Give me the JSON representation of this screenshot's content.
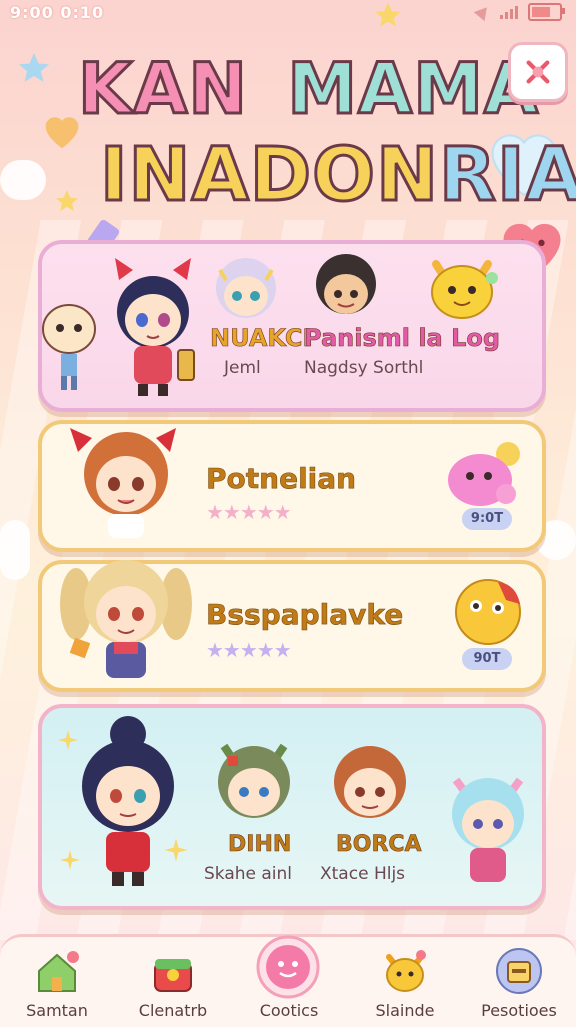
{
  "status_bar": {
    "time": "9:00 0:10"
  },
  "title": {
    "line1": [
      "KAN",
      "MAMA"
    ],
    "line2": [
      "INADON",
      "RIA"
    ]
  },
  "cards": [
    {
      "names": [
        "NUAKCI",
        "Panisml la Log"
      ],
      "subtitles": [
        "Jeml",
        "Nagdsy Sorthl"
      ]
    },
    {
      "label": "Potnelian",
      "stars": "★★★★★",
      "badge": "9:0T"
    },
    {
      "label": "Bsspaplavke",
      "stars": "★★★★★",
      "badge": "90T"
    },
    {
      "names": [
        "DIHN",
        "BORCA"
      ],
      "subtitles": [
        "Skahe ainl",
        "Xtace Hljs"
      ]
    }
  ],
  "nav": [
    {
      "label": "Samtan",
      "icon": "house-icon"
    },
    {
      "label": "Clenatrb",
      "icon": "gift-icon"
    },
    {
      "label": "Cootics",
      "icon": "smiley-icon"
    },
    {
      "label": "Slainde",
      "icon": "cat-icon"
    },
    {
      "label": "Pesotioes",
      "icon": "box-icon"
    }
  ],
  "colors": {
    "accent_pink": "#f58fb3",
    "card_border_gold": "#f1c978",
    "nav_bg": "#fff5f0"
  }
}
